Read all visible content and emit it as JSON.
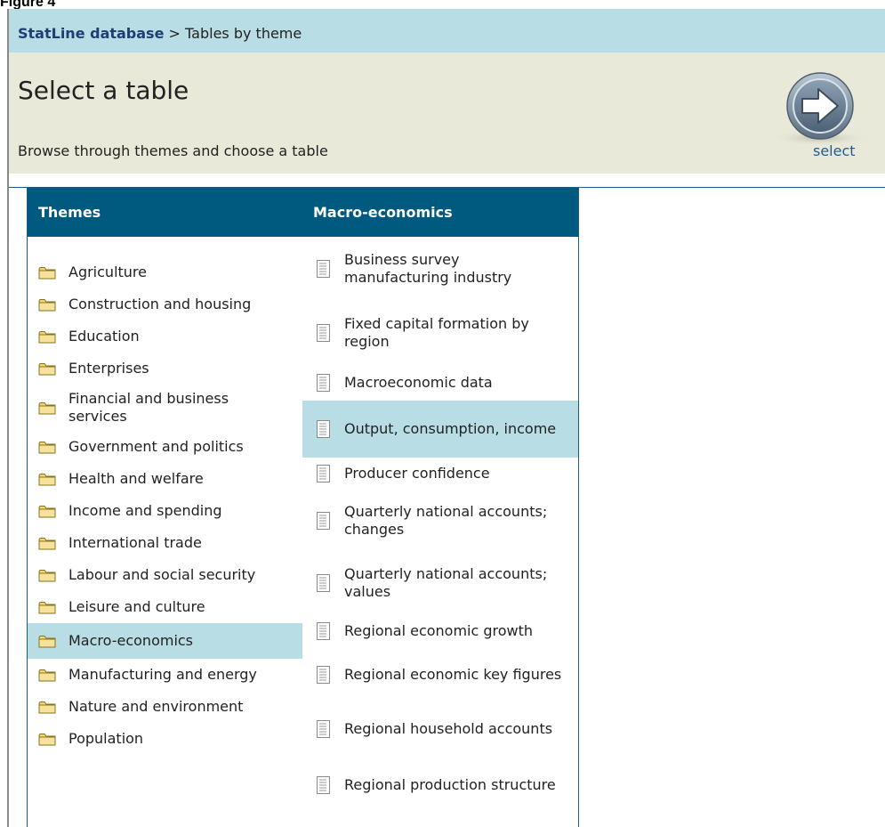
{
  "figure_label": "Figure 4",
  "breadcrumb": {
    "root": "StatLine database",
    "separator": ">",
    "current": "Tables by theme"
  },
  "header": {
    "title": "Select a table",
    "subtitle": "Browse through themes and choose a table",
    "select_label": "select"
  },
  "themes_column": {
    "heading": "Themes",
    "selected": "Macro-economics",
    "items": [
      {
        "label": "Agriculture",
        "icon": "folder-icon"
      },
      {
        "label": "Construction and housing",
        "icon": "folder-icon"
      },
      {
        "label": "Education",
        "icon": "folder-icon"
      },
      {
        "label": "Enterprises",
        "icon": "folder-icon"
      },
      {
        "label": "Financial and business services",
        "icon": "folder-icon"
      },
      {
        "label": "Government and politics",
        "icon": "folder-icon"
      },
      {
        "label": "Health and welfare",
        "icon": "folder-icon"
      },
      {
        "label": "Income and spending",
        "icon": "folder-icon"
      },
      {
        "label": "International trade",
        "icon": "folder-icon"
      },
      {
        "label": "Labour and social security",
        "icon": "folder-icon"
      },
      {
        "label": "Leisure and culture",
        "icon": "folder-icon"
      },
      {
        "label": "Macro-economics",
        "icon": "folder-icon"
      },
      {
        "label": "Manufacturing and energy",
        "icon": "folder-icon"
      },
      {
        "label": "Nature and environment",
        "icon": "folder-icon"
      },
      {
        "label": "Population",
        "icon": "folder-icon"
      }
    ]
  },
  "tables_column": {
    "heading": "Macro-economics",
    "selected": "Output, consumption, income",
    "items": [
      {
        "label": "Business survey manufacturing industry",
        "icon": "document-icon"
      },
      {
        "label": "Fixed capital formation by region",
        "icon": "document-icon"
      },
      {
        "label": "Macroeconomic data",
        "icon": "document-icon"
      },
      {
        "label": "Output, consumption, income",
        "icon": "document-icon"
      },
      {
        "label": "Producer confidence",
        "icon": "document-icon"
      },
      {
        "label": "Quarterly national accounts; changes",
        "icon": "document-icon"
      },
      {
        "label": "Quarterly national accounts; values",
        "icon": "document-icon"
      },
      {
        "label": "Regional economic growth",
        "icon": "document-icon"
      },
      {
        "label": "Regional economic key figures",
        "icon": "document-icon"
      },
      {
        "label": "Regional household accounts",
        "icon": "document-icon"
      },
      {
        "label": "Regional production structure",
        "icon": "document-icon"
      }
    ]
  },
  "colors": {
    "breadcrumb_bar": "#b9dde5",
    "header_panel": "#e9e9d9",
    "column_header": "#00597e",
    "selected_row": "#b9dde5",
    "link_blue": "#1d5d97"
  }
}
